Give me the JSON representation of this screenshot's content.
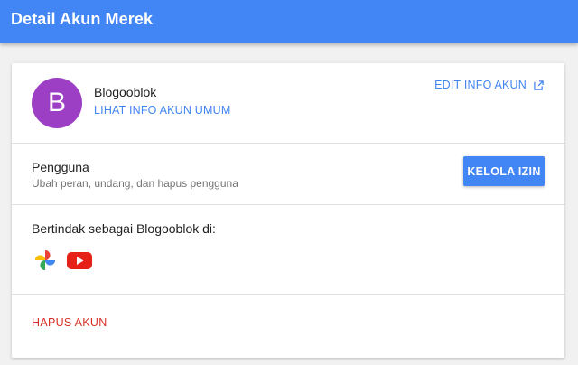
{
  "header": {
    "title": "Detail Akun Merek"
  },
  "account": {
    "avatar_letter": "B",
    "avatar_color": "#9c3fc4",
    "name": "Blogooblok",
    "public_info_link": "LIHAT INFO AKUN UMUM",
    "edit_info_link": "EDIT INFO AKUN",
    "edit_icon": "open-in-new-icon"
  },
  "users": {
    "title": "Pengguna",
    "subtitle": "Ubah peran, undang, dan hapus pengguna",
    "manage_button": "KELOLA IZIN"
  },
  "act_as": {
    "title": "Bertindak sebagai Blogooblok di:",
    "services": [
      {
        "icon": "google-photos-icon"
      },
      {
        "icon": "youtube-icon"
      }
    ]
  },
  "delete": {
    "label": "HAPUS AKUN",
    "color": "#d93025"
  },
  "colors": {
    "accent": "#4285f4",
    "background": "#f1f1f1"
  }
}
